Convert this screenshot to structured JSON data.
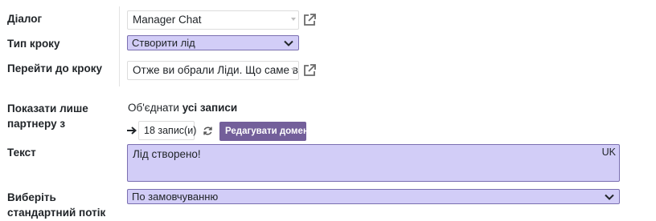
{
  "fields": {
    "dialog": {
      "label": "Діалог",
      "value": "Manager Chat"
    },
    "step_type": {
      "label": "Тип кроку",
      "value": "Створити лід"
    },
    "goto_step": {
      "label": "Перейти до кроку",
      "value": "Отже ви обрали Ліди. Що саме в"
    },
    "partner_filter": {
      "label": "Показати лише партнеру з",
      "prefix": "Об'єднати",
      "emphasis": "усі записи",
      "count_label": "18 запис(и)",
      "edit_domain_label": "Редагувати домен"
    },
    "text": {
      "label": "Текст",
      "value": "Лід створено!",
      "lang": "UK"
    },
    "default_flow": {
      "label": "Виберіть стандартний потік",
      "value": "По замовчуванню"
    }
  },
  "colors": {
    "purple_fill": "#d2cdf7",
    "purple_border": "#7a6fb0",
    "button_purple": "#735f9a"
  },
  "icons": [
    "external-link-icon",
    "chevron-down-icon",
    "arrow-right-icon",
    "refresh-icon"
  ]
}
